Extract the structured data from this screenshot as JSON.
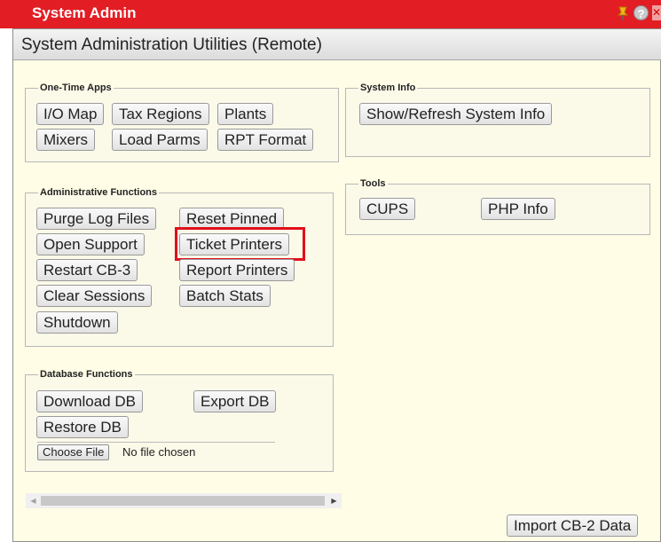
{
  "titlebar": {
    "title": "System Admin",
    "icons": [
      "pin-icon",
      "help-icon",
      "close-icon"
    ]
  },
  "window": {
    "header": "System Administration Utilities (Remote)"
  },
  "one_time_apps": {
    "legend": "One-Time Apps",
    "buttons": [
      "I/O Map",
      "Tax Regions",
      "Plants",
      "Mixers",
      "Load Parms",
      "RPT Format"
    ]
  },
  "system_info": {
    "legend": "System Info",
    "buttons": [
      "Show/Refresh System Info"
    ]
  },
  "tools": {
    "legend": "Tools",
    "buttons": [
      "CUPS",
      "PHP Info"
    ]
  },
  "admin_functions": {
    "legend": "Administrative Functions",
    "buttons": [
      "Purge Log Files",
      "Reset Pinned",
      "Open Support",
      "Ticket Printers",
      "Restart CB-3",
      "Report Printers",
      "Clear Sessions",
      "Batch Stats",
      "Shutdown"
    ],
    "highlighted": "Ticket Printers"
  },
  "database_functions": {
    "legend": "Database Functions",
    "buttons": [
      "Download DB",
      "Export DB",
      "Restore DB"
    ],
    "file_input": {
      "button": "Choose File",
      "status": "No file chosen"
    }
  },
  "footer": {
    "import_button": "Import CB-2 Data"
  },
  "colors": {
    "titlebar": "#e31d24",
    "panel_bg": "#fffde6",
    "highlight": "#e0101a"
  }
}
